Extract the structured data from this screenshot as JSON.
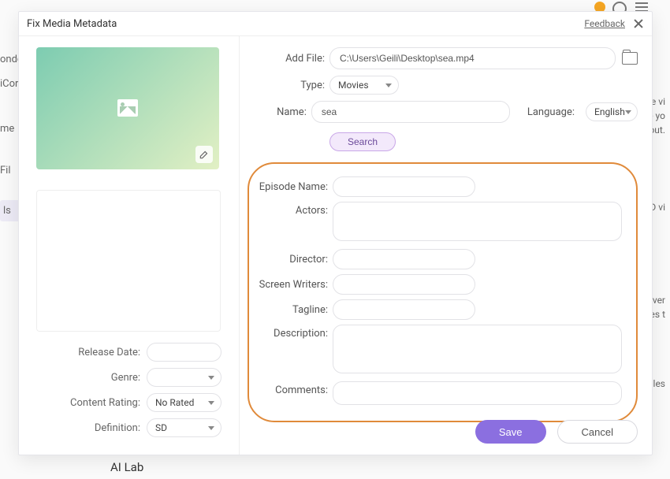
{
  "backdrop": {
    "frag1": "onde",
    "frag2": "iCor",
    "frag3": "me",
    "frag4": "Fil",
    "frag5": "ls",
    "right1": "se vi",
    "right2": "ke yo",
    "right3": "out.",
    "right4": "ID vi",
    "right5": "nver",
    "right6": "ges t",
    "right7": "files",
    "bottom": "AI Lab"
  },
  "modal": {
    "title": "Fix Media Metadata",
    "feedback": "Feedback"
  },
  "left": {
    "release_date_label": "Release Date:",
    "release_date_value": "",
    "genre_label": "Genre:",
    "genre_value": "",
    "content_rating_label": "Content Rating:",
    "content_rating_value": "No Rated",
    "definition_label": "Definition:",
    "definition_value": "SD"
  },
  "right": {
    "add_file_label": "Add File:",
    "add_file_value": "C:\\Users\\Geili\\Desktop\\sea.mp4",
    "type_label": "Type:",
    "type_value": "Movies",
    "name_label": "Name:",
    "name_value": "sea",
    "language_label": "Language:",
    "language_value": "English",
    "search_label": "Search",
    "episode_name_label": "Episode Name:",
    "episode_name_value": "",
    "actors_label": "Actors:",
    "actors_value": "",
    "director_label": "Director:",
    "director_value": "",
    "screen_writers_label": "Screen Writers:",
    "screen_writers_value": "",
    "tagline_label": "Tagline:",
    "tagline_value": "",
    "description_label": "Description:",
    "description_value": "",
    "comments_label": "Comments:",
    "comments_value": ""
  },
  "actions": {
    "save": "Save",
    "cancel": "Cancel"
  }
}
